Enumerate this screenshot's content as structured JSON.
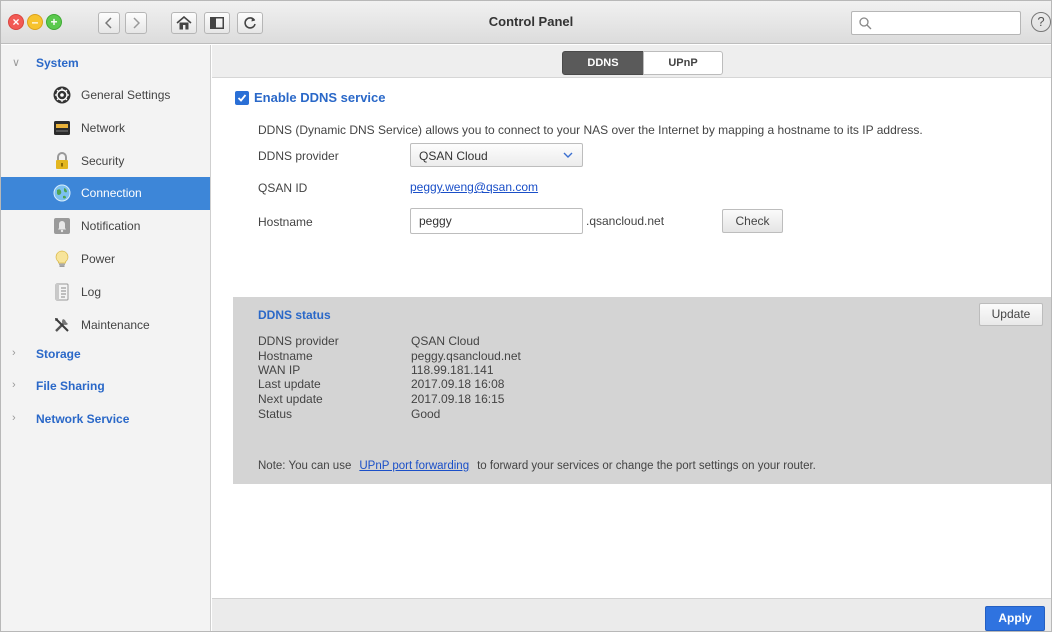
{
  "window": {
    "title": "Control Panel",
    "search_placeholder": "",
    "help_label": "?"
  },
  "sidebar": {
    "sections": [
      {
        "label": "System",
        "expanded": true
      },
      {
        "label": "Storage",
        "expanded": false
      },
      {
        "label": "File Sharing",
        "expanded": false
      },
      {
        "label": "Network Service",
        "expanded": false
      }
    ],
    "system_items": [
      {
        "label": "General Settings",
        "icon": "general-settings-icon"
      },
      {
        "label": "Network",
        "icon": "network-icon"
      },
      {
        "label": "Security",
        "icon": "lock-icon"
      },
      {
        "label": "Connection",
        "icon": "globe-icon",
        "active": true
      },
      {
        "label": "Notification",
        "icon": "notification-icon"
      },
      {
        "label": "Power",
        "icon": "bulb-icon"
      },
      {
        "label": "Log",
        "icon": "log-icon"
      },
      {
        "label": "Maintenance",
        "icon": "tools-icon"
      }
    ]
  },
  "tabs": [
    {
      "label": "DDNS",
      "active": true
    },
    {
      "label": "UPnP",
      "active": false
    }
  ],
  "ddns": {
    "enable_label": "Enable DDNS service",
    "enabled": true,
    "description": "DDNS (Dynamic DNS Service) allows you to connect to your NAS over the Internet by mapping a hostname to its IP address.",
    "provider_label": "DDNS provider",
    "provider_value": "QSAN Cloud",
    "qsan_id_label": "QSAN ID",
    "qsan_id_value": "peggy.weng@qsan.com",
    "hostname_label": "Hostname",
    "hostname_value": "peggy",
    "hostname_suffix": ".qsancloud.net",
    "check_label": "Check"
  },
  "status": {
    "title": "DDNS status",
    "update_label": "Update",
    "rows": [
      {
        "key": "DDNS provider",
        "value": "QSAN Cloud"
      },
      {
        "key": "Hostname",
        "value": "peggy.qsancloud.net"
      },
      {
        "key": "WAN IP",
        "value": "118.99.181.141"
      },
      {
        "key": "Last update",
        "value": "2017.09.18 16:08"
      },
      {
        "key": "Next update",
        "value": "2017.09.18 16:15"
      },
      {
        "key": "Status",
        "value": "Good"
      }
    ],
    "note_prefix": "Note: You can use",
    "note_link": "UPnP port forwarding",
    "note_suffix": "to forward your services or change the port settings on your router."
  },
  "footer": {
    "apply_label": "Apply"
  },
  "colors": {
    "accent": "#2a68c8",
    "active_item": "#3d86d8",
    "apply": "#2f73e0",
    "status_panel": "#d4d4d4"
  }
}
